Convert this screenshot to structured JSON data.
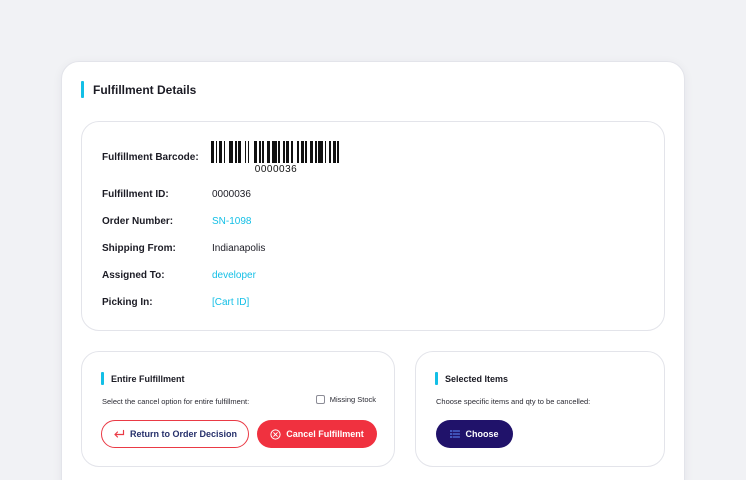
{
  "details": {
    "title": "Fulfillment Details",
    "barcode": {
      "label": "Fulfillment Barcode:",
      "value": "0000036"
    },
    "fields": [
      {
        "label": "Fulfillment ID:",
        "value": "0000036",
        "link": false
      },
      {
        "label": "Order Number:",
        "value": "SN-1098",
        "link": true
      },
      {
        "label": "Shipping From:",
        "value": "Indianapolis",
        "link": false
      },
      {
        "label": "Assigned To:",
        "value": "developer",
        "link": true
      },
      {
        "label": "Picking In:",
        "value": "[Cart ID]",
        "link": true
      }
    ]
  },
  "entire": {
    "title": "Entire Fulfillment",
    "description": "Select the cancel option for entire fulfillment:",
    "missing_stock_label": "Missing Stock",
    "missing_stock_checked": false,
    "return_button": "Return to Order Decision",
    "cancel_button": "Cancel Fulfillment"
  },
  "selected": {
    "title": "Selected Items",
    "description": "Choose specific items and qty to be cancelled:",
    "choose_button": "Choose"
  },
  "colors": {
    "accent": "#13bfe6",
    "danger": "#f0313f",
    "primary_dark": "#20126a"
  }
}
